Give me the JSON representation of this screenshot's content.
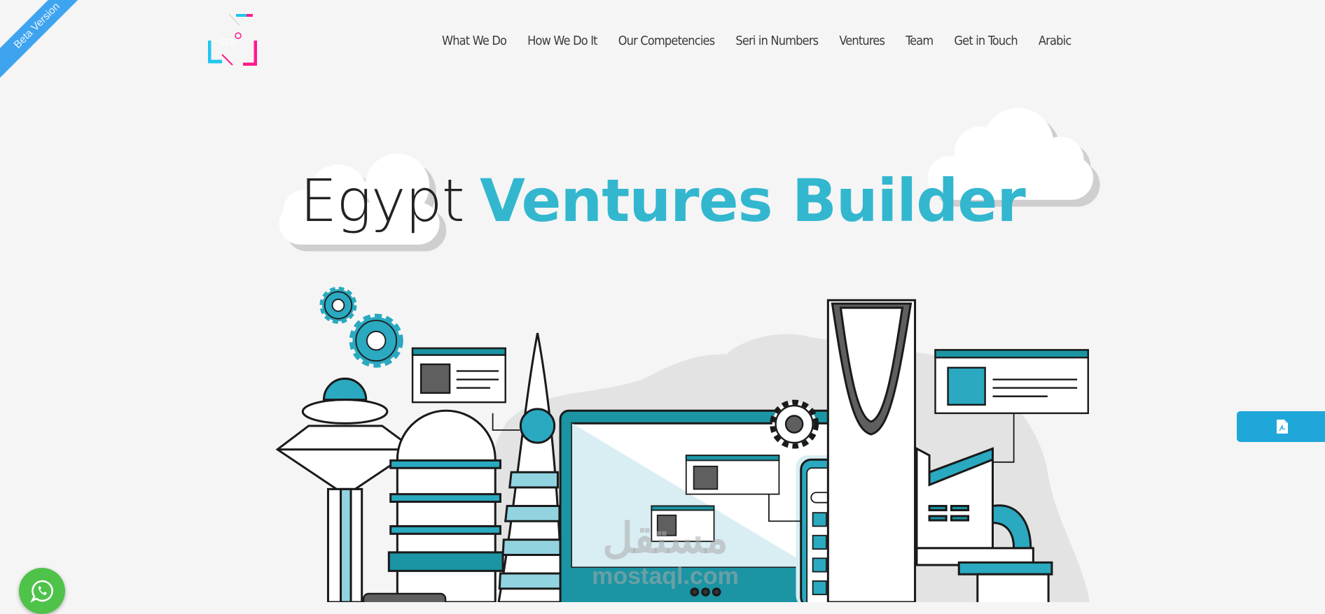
{
  "ribbon": {
    "label": "Beta Version"
  },
  "logo": {
    "text": "SERI"
  },
  "nav": {
    "items": [
      {
        "label": "What We Do"
      },
      {
        "label": "How We Do It"
      },
      {
        "label": "Our Competencies"
      },
      {
        "label": "Seri in Numbers"
      },
      {
        "label": "Ventures"
      },
      {
        "label": "Team"
      },
      {
        "label": "Get in Touch"
      },
      {
        "label": "Arabic"
      }
    ]
  },
  "hero": {
    "title_light": "Egypt",
    "title_bold": "Ventures Builder"
  },
  "pdf_button": {
    "icon": "file-pdf-icon"
  },
  "whatsapp_button": {
    "icon": "whatsapp-icon"
  },
  "watermark": {
    "arabic": "مستقل",
    "latin": "mostaql.com"
  },
  "colors": {
    "accent": "#33b7cf",
    "ribbon": "#3fa4ef",
    "pdf": "#1fa7d9",
    "whatsapp": "#4fc24a",
    "teal_dark": "#1b94a3"
  }
}
